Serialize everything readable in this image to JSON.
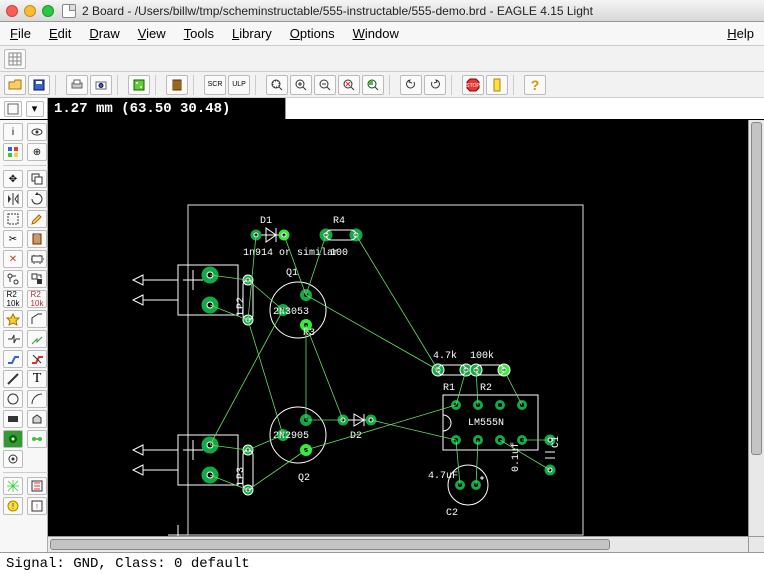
{
  "window": {
    "title": "2 Board - /Users/billw/tmp/scheminstructable/555-instructable/555-demo.brd - EAGLE 4.15 Light"
  },
  "menu": {
    "file": "File",
    "edit": "Edit",
    "draw": "Draw",
    "view": "View",
    "tools": "Tools",
    "library": "Library",
    "options": "Options",
    "window": "Window",
    "help": "Help"
  },
  "coord": {
    "readout": "1.27 mm (63.50 30.48)"
  },
  "status": {
    "text": "Signal: GND, Class: 0 default"
  },
  "pcb": {
    "labels": {
      "d1": "D1",
      "d1val": "1n914 or similar",
      "r4": "R4",
      "r4val": "100",
      "q1": "Q1",
      "q1val": "2N3053",
      "r3": "R3",
      "q2": "Q2",
      "q2val": "2N2905",
      "d2": "D2",
      "r1": "R1",
      "r1val": "4.7k",
      "r2": "R2",
      "r2val": "100k",
      "ic": "LM555N",
      "c1": "C1",
      "c1val": "0.1uf",
      "c2": "C2",
      "c2val": "4.7uF",
      "lp2": "LP2",
      "lp3": "LP3"
    }
  },
  "toolbar1_icons": [
    "grid"
  ],
  "toolbar2_icons": [
    "open",
    "save",
    "print",
    "cam",
    "board",
    "script",
    "run",
    "zoom-fit",
    "zoom-in",
    "zoom-out",
    "zoom-redraw",
    "zoom-select",
    "undo",
    "redo",
    "stop",
    "go",
    "help"
  ],
  "toolbox_icons": [
    "info",
    "show",
    "display",
    "mark",
    "move",
    "copy",
    "mirror",
    "rotate",
    "group",
    "change",
    "cut",
    "paste",
    "delete",
    "add",
    "name",
    "value",
    "smash",
    "miter",
    "split",
    "optimize",
    "route",
    "ripup",
    "wire",
    "text",
    "circle",
    "arc",
    "rect",
    "polygon",
    "via",
    "signal",
    "hole",
    "ratsnest",
    "drc",
    "errors"
  ]
}
